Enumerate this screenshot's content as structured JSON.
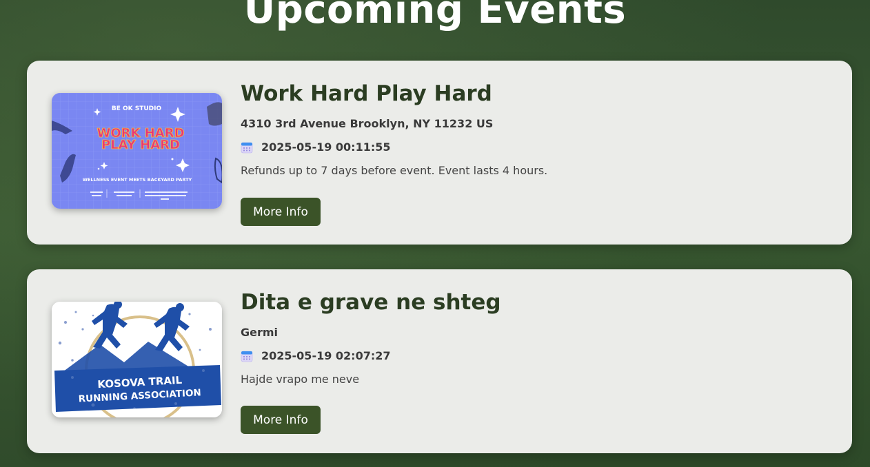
{
  "page": {
    "title": "Upcoming Events"
  },
  "events": [
    {
      "title": "Work Hard Play Hard",
      "address": "4310 3rd Avenue Brooklyn, NY 11232 US",
      "datetime": "2025-05-19 00:11:55",
      "description": "Refunds up to 7 days before event. Event lasts 4 hours.",
      "button_label": "More Info",
      "image": {
        "studio": "BE OK STUDIO",
        "line1": "WORK HARD",
        "line2": "PLAY HARD",
        "tagline": "WELLNESS EVENT MEETS BACKYARD PARTY"
      }
    },
    {
      "title": "Dita e grave ne shteg",
      "address": "Germi",
      "datetime": "2025-05-19 02:07:27",
      "description": "Hajde vrapo me neve",
      "button_label": "More Info",
      "image": {
        "line1": "KOSOVA TRAIL",
        "line2": "RUNNING ASSOCIATION"
      }
    }
  ],
  "colors": {
    "accent": "#3b5328",
    "card_bg": "#ebece9",
    "title": "#2b3d22"
  }
}
